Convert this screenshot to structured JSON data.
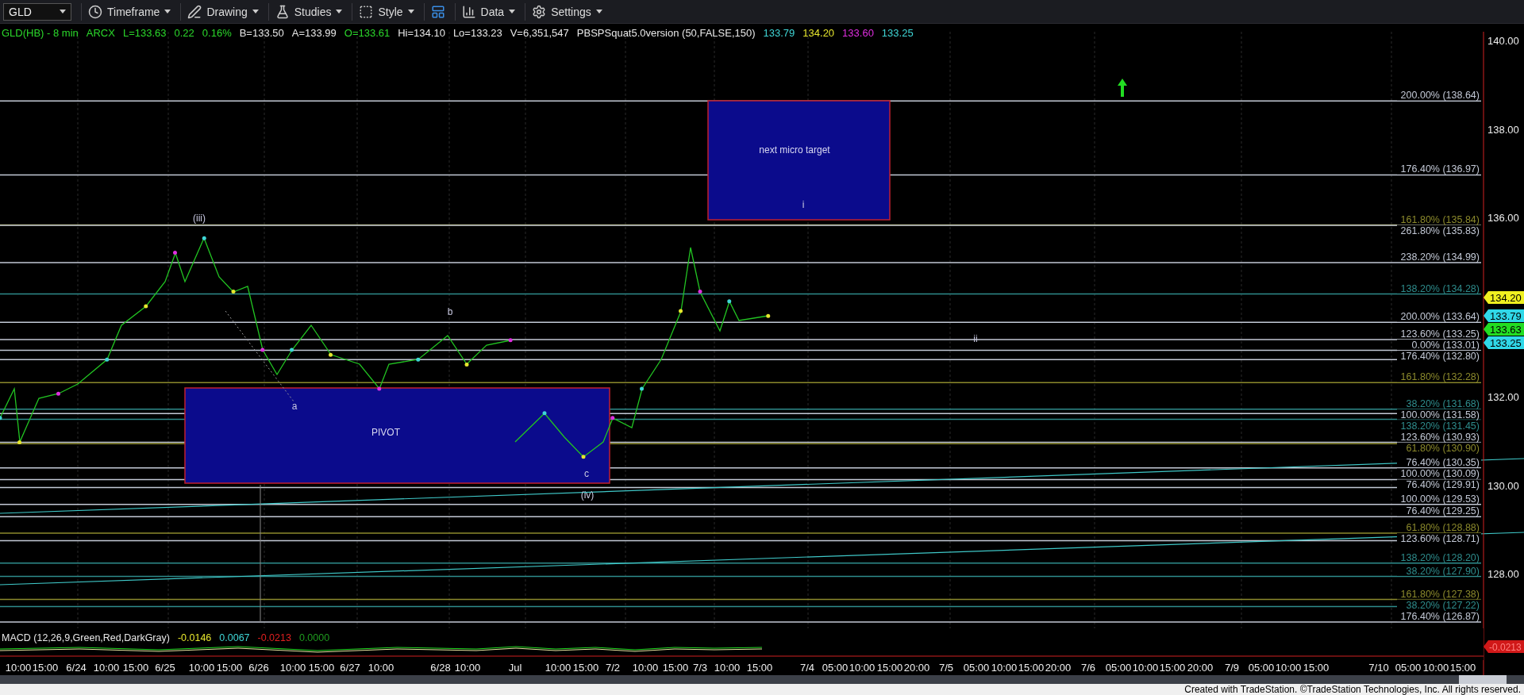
{
  "toolbar": {
    "symbol": "GLD",
    "menus": [
      {
        "kind": "timeframe",
        "label": "Timeframe"
      },
      {
        "kind": "drawing",
        "label": "Drawing"
      },
      {
        "kind": "studies",
        "label": "Studies"
      },
      {
        "kind": "style",
        "label": "Style"
      },
      {
        "kind": "layout"
      },
      {
        "kind": "data",
        "label": "Data"
      },
      {
        "kind": "settings",
        "label": "Settings"
      }
    ]
  },
  "legend": {
    "title": "GLD(HB) - 8 min",
    "items": [
      {
        "text": "ARCX",
        "color": "#2bd92b"
      },
      {
        "text": "L=133.63",
        "color": "#2bd92b"
      },
      {
        "text": "0.22",
        "color": "#2bd92b"
      },
      {
        "text": "0.16%",
        "color": "#2bd92b"
      },
      {
        "text": "B=133.50",
        "color": "#e8e8e8"
      },
      {
        "text": "A=133.99",
        "color": "#e8e8e8"
      },
      {
        "text": "O=133.61",
        "color": "#2bd92b"
      },
      {
        "text": "Hi=134.10",
        "color": "#e8e8e8"
      },
      {
        "text": "Lo=133.23",
        "color": "#e8e8e8"
      },
      {
        "text": "V=6,351,547",
        "color": "#e8e8e8"
      },
      {
        "text": "PBSPSquat5.0version (50,FALSE,150)",
        "color": "#e8e8e8"
      },
      {
        "text": "133.79",
        "color": "#3fd6d6"
      },
      {
        "text": "134.20",
        "color": "#e6e62e"
      },
      {
        "text": "133.60",
        "color": "#e02ee0"
      },
      {
        "text": "133.25",
        "color": "#3fd6d6"
      }
    ]
  },
  "chart": {
    "boxes": [
      "PIVOT",
      "next micro target"
    ],
    "wave_labels": [
      "(iii)",
      "a",
      "b",
      "c",
      "(iv)",
      "i",
      "ii"
    ],
    "fib_levels": [
      {
        "label": "200.00% (138.64)",
        "kind": "gray"
      },
      {
        "label": "176.40% (136.97)",
        "kind": "gray"
      },
      {
        "label": "161.80% (135.84)",
        "kind": "olive"
      },
      {
        "label": "261.80% (135.83)",
        "kind": "gray"
      },
      {
        "label": "238.20% (134.99)",
        "kind": "gray"
      },
      {
        "label": "138.20% (134.28)",
        "kind": "teal"
      },
      {
        "label": "200.00% (133.64)",
        "kind": "gray"
      },
      {
        "label": "123.60% (133.25)",
        "kind": "gray"
      },
      {
        "label": "0.00% (133.01)",
        "kind": "gray"
      },
      {
        "label": "176.40% (132.80)",
        "kind": "gray"
      },
      {
        "label": "161.80% (132.28)",
        "kind": "olive"
      },
      {
        "label": "38.20% (131.68)",
        "kind": "teal"
      },
      {
        "label": "100.00% (131.58)",
        "kind": "gray"
      },
      {
        "label": "138.20% (131.45)",
        "kind": "teal"
      },
      {
        "label": "123.60% (130.93)",
        "kind": "gray"
      },
      {
        "label": "61.80% (130.90)",
        "kind": "olive"
      },
      {
        "label": "76.40% (130.35)",
        "kind": "gray"
      },
      {
        "label": "100.00% (130.09)",
        "kind": "gray"
      },
      {
        "label": "76.40% (129.91)",
        "kind": "gray"
      },
      {
        "label": "100.00% (129.53)",
        "kind": "gray"
      },
      {
        "label": "76.40% (129.25)",
        "kind": "gray"
      },
      {
        "label": "61.80% (128.88)",
        "kind": "olive"
      },
      {
        "label": "123.60% (128.71)",
        "kind": "gray"
      },
      {
        "label": "138.20% (128.20)",
        "kind": "teal"
      },
      {
        "label": "38.20% (127.90)",
        "kind": "teal"
      },
      {
        "label": "161.80% (127.38)",
        "kind": "olive"
      },
      {
        "label": "38.20% (127.22)",
        "kind": "teal"
      },
      {
        "label": "176.40% (126.87)",
        "kind": "gray"
      }
    ],
    "price_ticks": [
      "140.00",
      "138.00",
      "136.00",
      "132.00",
      "130.00",
      "128.00"
    ],
    "price_tags": [
      {
        "text": "134.20",
        "color": "#f0f020"
      },
      {
        "text": "133.79",
        "color": "#30d8e8"
      },
      {
        "text": "133.63",
        "color": "#22dd22"
      },
      {
        "text": "133.25",
        "color": "#30d8e8"
      }
    ]
  },
  "macd": {
    "title": "MACD (12,26,9,Green,Red,DarkGray)",
    "values": [
      {
        "text": "-0.0146",
        "color": "#e6e62e"
      },
      {
        "text": "0.0067",
        "color": "#3fd6d6"
      },
      {
        "text": "-0.0213",
        "color": "#e02020"
      },
      {
        "text": "0.0000",
        "color": "#1f9a1f"
      }
    ],
    "tag": "-0.0213"
  },
  "time_axis": [
    "10:00",
    "15:00",
    "6/24",
    "10:00",
    "15:00",
    "6/25",
    "10:00",
    "15:00",
    "6/26",
    "10:00",
    "15:00",
    "6/27",
    "10:00",
    "6/28",
    "10:00",
    "Jul",
    "10:00",
    "15:00",
    "7/2",
    "10:00",
    "15:00",
    "7/3",
    "10:00",
    "15:00",
    "7/4",
    "05:00",
    "10:00",
    "15:00",
    "20:00",
    "7/5",
    "05:00",
    "10:00",
    "15:00",
    "20:00",
    "7/6",
    "05:00",
    "10:00",
    "15:00",
    "20:00",
    "7/9",
    "05:00",
    "10:00",
    "15:00",
    "7/10",
    "05:00",
    "10:00",
    "15:00"
  ],
  "footer": "Created with TradeStation. ©TradeStation Technologies, Inc. All rights reserved."
}
